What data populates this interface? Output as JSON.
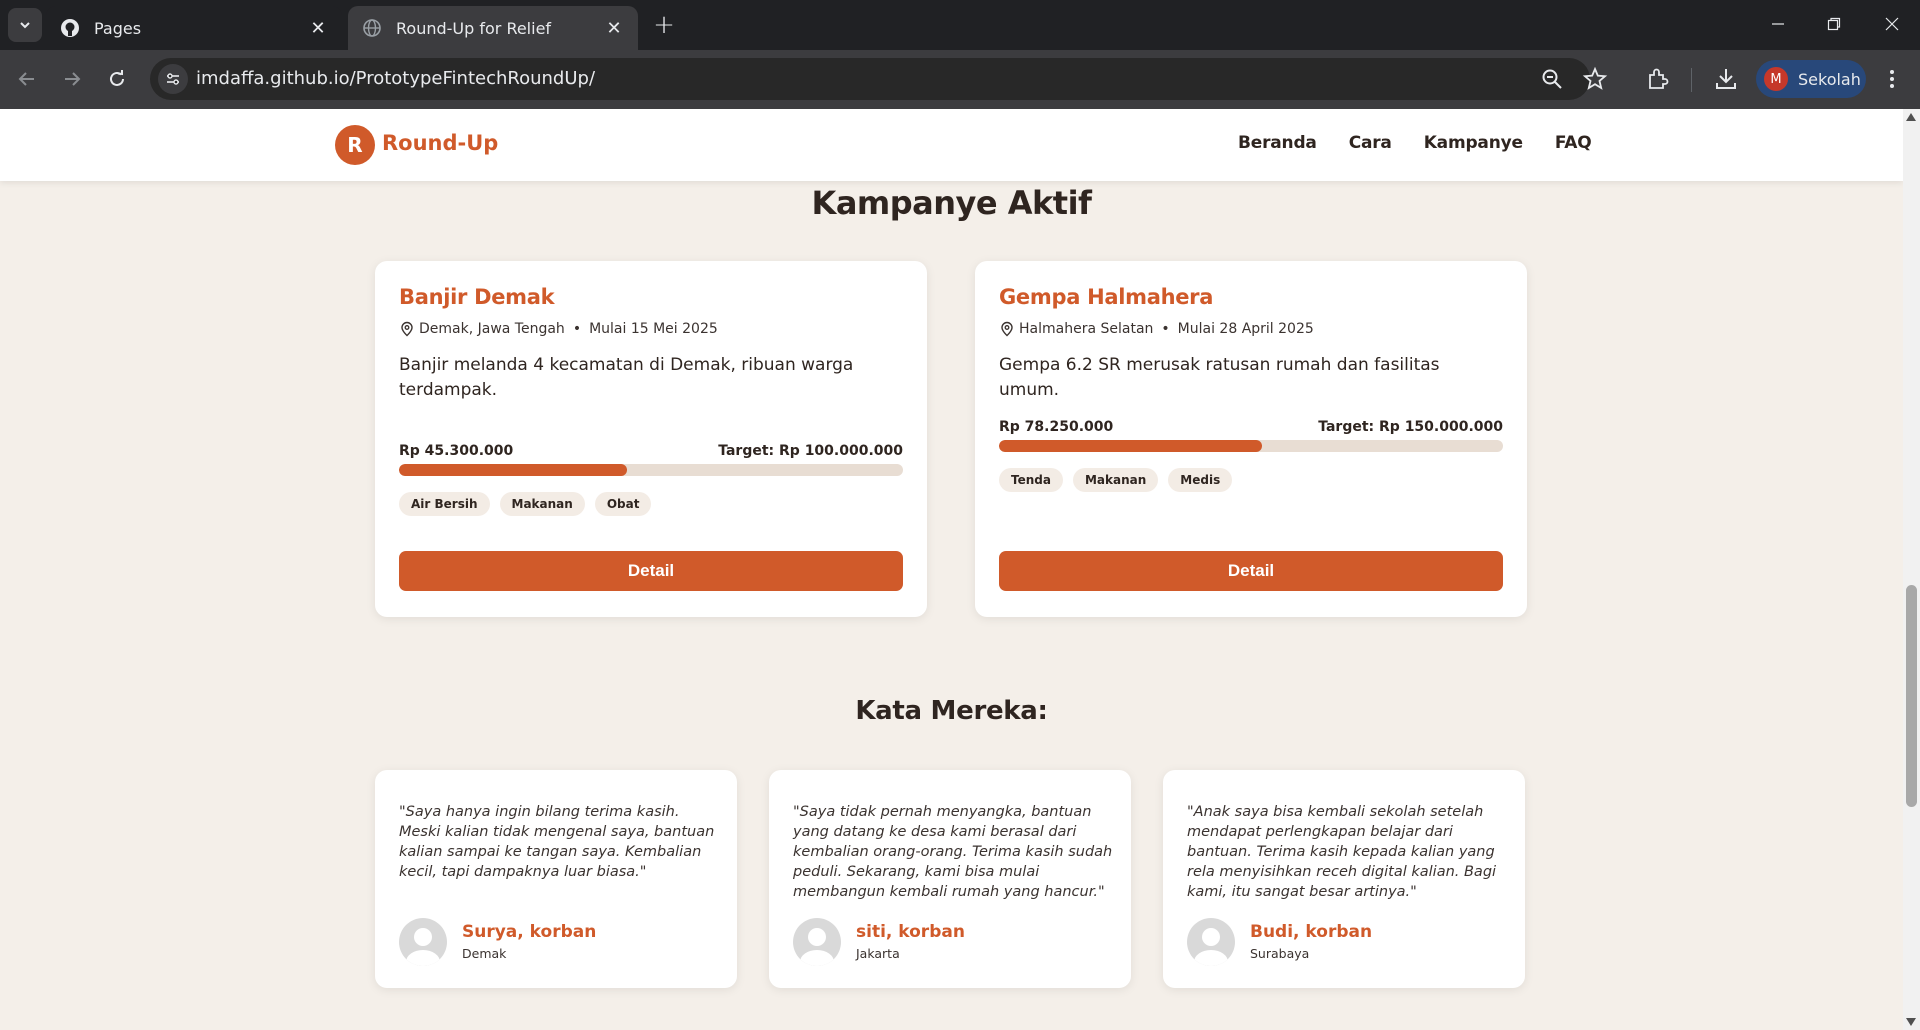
{
  "browser": {
    "tabs": [
      {
        "title": "Pages",
        "icon": "github-icon",
        "active": false
      },
      {
        "title": "Round-Up for Relief",
        "icon": "globe-icon",
        "active": true
      }
    ],
    "url": "imdaffa.github.io/PrototypeFintechRoundUp/",
    "profile": {
      "initial": "M",
      "name": "Sekolah"
    }
  },
  "site": {
    "logo_letter": "R",
    "logo_text": "Round-Up",
    "nav": [
      "Beranda",
      "Cara",
      "Kampanye",
      "FAQ"
    ],
    "accent_color": "#d05a2a"
  },
  "campaigns_title": "Kampanye Aktif",
  "campaigns": [
    {
      "name": "Banjir Demak",
      "location": "Demak, Jawa Tengah",
      "start": "Mulai 15 Mei 2025",
      "description": "Banjir melanda 4 kecamatan di Demak, ribuan warga terdampak.",
      "raised": "Rp 45.300.000",
      "target": "Target: Rp 100.000.000",
      "progress": 0.453,
      "tags": [
        "Air Bersih",
        "Makanan",
        "Obat"
      ],
      "button": "Detail"
    },
    {
      "name": "Gempa Halmahera",
      "location": "Halmahera Selatan",
      "start": "Mulai 28 April 2025",
      "description": "Gempa 6.2 SR merusak ratusan rumah dan fasilitas umum.",
      "raised": "Rp 78.250.000",
      "target": "Target: Rp 150.000.000",
      "progress": 0.522,
      "tags": [
        "Tenda",
        "Makanan",
        "Medis"
      ],
      "button": "Detail"
    }
  ],
  "testimonials_title": "Kata Mereka:",
  "testimonials": [
    {
      "quote": "\"Saya hanya ingin bilang terima kasih. Meski kalian tidak mengenal saya, bantuan kalian sampai ke tangan saya. Kembalian kecil, tapi dampaknya luar biasa.\"",
      "name": "Surya, korban",
      "location": "Demak"
    },
    {
      "quote": "\"Saya tidak pernah menyangka, bantuan yang datang ke desa kami berasal dari kembalian orang-orang. Terima kasih sudah peduli. Sekarang, kami bisa mulai membangun kembali rumah yang hancur.\"",
      "name": "siti, korban",
      "location": "Jakarta"
    },
    {
      "quote": "\"Anak saya bisa kembali sekolah setelah mendapat perlengkapan belajar dari bantuan. Terima kasih kepada kalian yang rela menyisihkan receh digital kalian. Bagi kami, itu sangat besar artinya.\"",
      "name": "Budi, korban",
      "location": "Surabaya"
    }
  ]
}
